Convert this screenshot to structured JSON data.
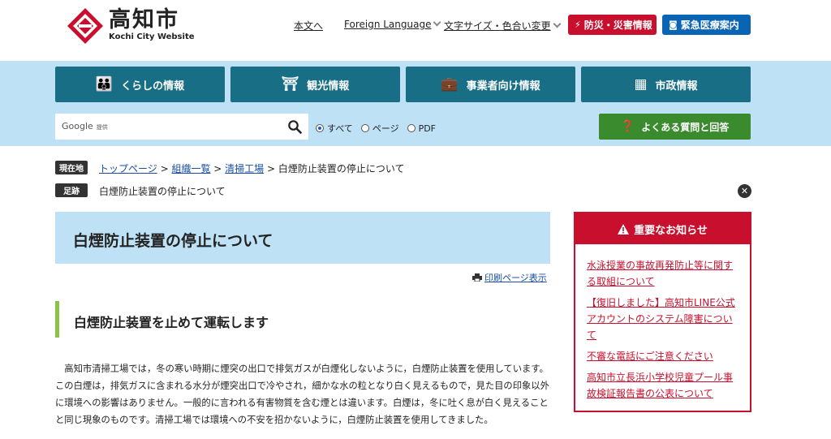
{
  "header": {
    "logo_title": "高知市",
    "logo_sub": "Kochi City Website",
    "util_links": [
      "本文へ",
      "Foreign Language",
      "文字サイズ・色合い変更"
    ],
    "disaster_btn": "防災・災害情報",
    "medical_btn": "緊急医療案内"
  },
  "nav": {
    "items": [
      "くらしの情報",
      "観光情報",
      "事業者向け情報",
      "市政情報"
    ]
  },
  "search": {
    "brand": "Google",
    "brand_small": "提供",
    "placeholder": "",
    "options": [
      "すべて",
      "ページ",
      "PDF"
    ],
    "selected": "すべて"
  },
  "faq_btn": "よくある質問と回答",
  "breadcrumb": {
    "current_label": "現在地",
    "links": [
      "トップページ",
      "組織一覧",
      "清掃工場"
    ],
    "separator": " > ",
    "current": "白煙防止装置の停止について",
    "history_label": "足跡",
    "history_item": "白煙防止装置の停止について"
  },
  "main": {
    "title": "白煙防止装置の停止について",
    "print_link": "印刷ページ表示",
    "heading": "白煙防止装置を止めて運転します",
    "body": "　高知市清掃工場では，冬の寒い時期に煙突の出口で排気ガスが白煙化しないように，白煙防止装置を使用しています。この白煙は，排気ガスに含まれる水分が煙突出口で冷やされ，細かな水の粒となり白く見えるもので，見た目の印象以外に環境への影響はありません。一般的に言われる有害物質を含む煙とは違います。白煙は，冬に吐く息が白く見えることと同じ現象のものです。清掃工場では環境への不安を招かないように，白煙防止装置を使用してきました。"
  },
  "notice": {
    "title": "重要なお知らせ",
    "items": [
      "水泳授業の事故再発防止等に関する取組について",
      "【復旧しました】高知市LINE公式アカウントのシステム障害について",
      "不審な電話にご注意ください",
      "高知市立長浜小学校児童プール事故検証報告書の公表について"
    ]
  },
  "colors": {
    "nav_teal": "#176e85",
    "band_blue": "#bfe1f5",
    "alert_red": "#c8102e",
    "medical_blue": "#0a64b4",
    "faq_green": "#3a8a2e",
    "heading_accent": "#8bc34a"
  }
}
